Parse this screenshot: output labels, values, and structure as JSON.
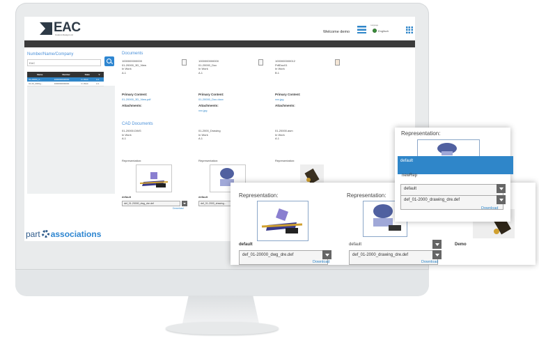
{
  "header": {
    "logo": "EAC",
    "logo_sub": "Custom Design Ltd",
    "welcome": "Welcome demo",
    "language_label": "Language",
    "language": "Englisch",
    "menu_icon": "hamburger-menu-icon",
    "apps_icon": "grid-apps-icon"
  },
  "sidebar": {
    "title": "Number/Name/Company",
    "search_value": "EAC",
    "search_icon": "search-icon",
    "table": {
      "headers": [
        "Name",
        "Number",
        "State",
        "V"
      ],
      "rows": [
        [
          "01-20000_0...",
          "1000000000000",
          "In Work",
          "A.1"
        ],
        [
          "01-20_0000g...",
          "1000000000000",
          "In Work",
          "A.1"
        ]
      ]
    },
    "brand": {
      "part": "part",
      "associations": "associations"
    }
  },
  "documents": {
    "title": "Documents",
    "items": [
      {
        "number": "1000000000000",
        "name": "01-20000_3D_View",
        "state": "In Work",
        "version": "A.1"
      },
      {
        "number": "1000000000000",
        "name": "01-20000_Doc",
        "state": "In Work",
        "version": "A.1"
      },
      {
        "number": "1000000000012",
        "name": "PdfDoc01",
        "state": "In Work",
        "version": "B.1"
      }
    ],
    "primary_label": "Primary Content:",
    "primary": [
      "01-20000_3D_View.pdf",
      "01-20000_Doc.docx",
      "xxx.jpg"
    ],
    "attachments_label": "Attachments:",
    "attachments": [
      "",
      "xxx.jpg",
      ""
    ]
  },
  "cad": {
    "title": "CAD Documents",
    "items": [
      {
        "name": "01-20000.DWG",
        "state": "In Work",
        "version": "A.1"
      },
      {
        "name": "01-2000_Drawing",
        "state": "In Work",
        "version": "A.1"
      },
      {
        "name": "01-20000.asm",
        "state": "In Work",
        "version": "A.1"
      }
    ],
    "rep_label": "Representation:",
    "rep_values": [
      "default",
      "default"
    ],
    "rep_files": [
      "def_01-20000_dwg_dre.def",
      "def_01-2000_drawing..."
    ],
    "download": "Download"
  },
  "popup_main": {
    "left": {
      "title": "Representation:",
      "label": "default",
      "file": "def_01-20000_dwg_dre.def",
      "download": "Download"
    },
    "right": {
      "title": "Representation:",
      "value": "default",
      "file": "def_01-2000_drawing_dre.def",
      "download": "Download",
      "extra_label": "Demo"
    }
  },
  "popup_small": {
    "title": "Representation:",
    "options": [
      "default",
      "newRep"
    ],
    "selected_value": "default",
    "file": "def_01-2000_drawing_dre.def",
    "download": "Download"
  },
  "colors": {
    "accent": "#2f86c9",
    "header_bar": "#3b3b3b",
    "brand": "#2e5a8a"
  }
}
